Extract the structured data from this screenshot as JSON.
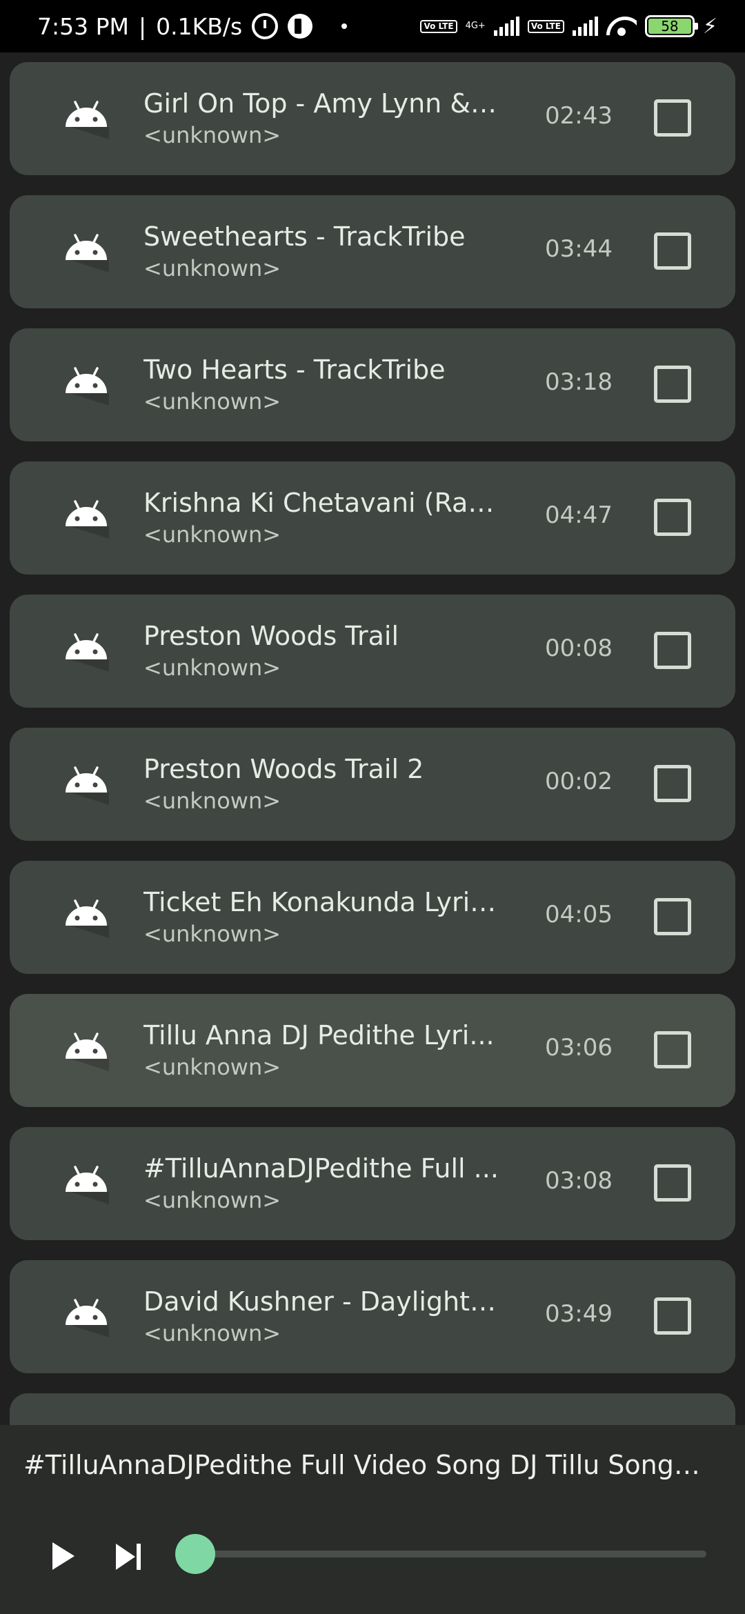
{
  "status_bar": {
    "time": "7:53 PM",
    "separator": "|",
    "speed": "0.1KB/s",
    "volte_label": "Vo LTE",
    "network_label": "4G+",
    "battery": "58"
  },
  "colors": {
    "card": "#404641",
    "card_active": "#4a504a",
    "accent": "#7fd8a4",
    "background": "#1f201f"
  },
  "songs": [
    {
      "title": "Girl On Top - Amy Lynn & t...",
      "artist": "<unknown>",
      "duration": "02:43",
      "checked": false
    },
    {
      "title": "Sweethearts - TrackTribe",
      "artist": "<unknown>",
      "duration": "03:44",
      "checked": false
    },
    {
      "title": "Two Hearts - TrackTribe",
      "artist": "<unknown>",
      "duration": "03:18",
      "checked": false
    },
    {
      "title": "Krishna Ki Chetavani (Ras...",
      "artist": "<unknown>",
      "duration": "04:47",
      "checked": false
    },
    {
      "title": "Preston Woods Trail",
      "artist": "<unknown>",
      "duration": "00:08",
      "checked": false
    },
    {
      "title": "Preston Woods Trail 2",
      "artist": "<unknown>",
      "duration": "00:02",
      "checked": false
    },
    {
      "title": "Ticket Eh Konakunda Lyric...",
      "artist": "<unknown>",
      "duration": "04:05",
      "checked": false
    },
    {
      "title": "Tillu Anna DJ Pedithe Lyri...",
      "artist": "<unknown>",
      "duration": "03:06",
      "checked": false
    },
    {
      "title": "#TilluAnnaDJPedithe Full ...",
      "artist": "<unknown>",
      "duration": "03:08",
      "checked": false
    },
    {
      "title": "David Kushner - Daylight (...",
      "artist": "<unknown>",
      "duration": "03:49",
      "checked": false
    }
  ],
  "player": {
    "now_playing": "#TilluAnnaDJPedithe Full Video Song DJ Tillu Songs Si...",
    "progress": 0.03,
    "play_icon": "play-icon",
    "next_icon": "skip-next-icon"
  }
}
